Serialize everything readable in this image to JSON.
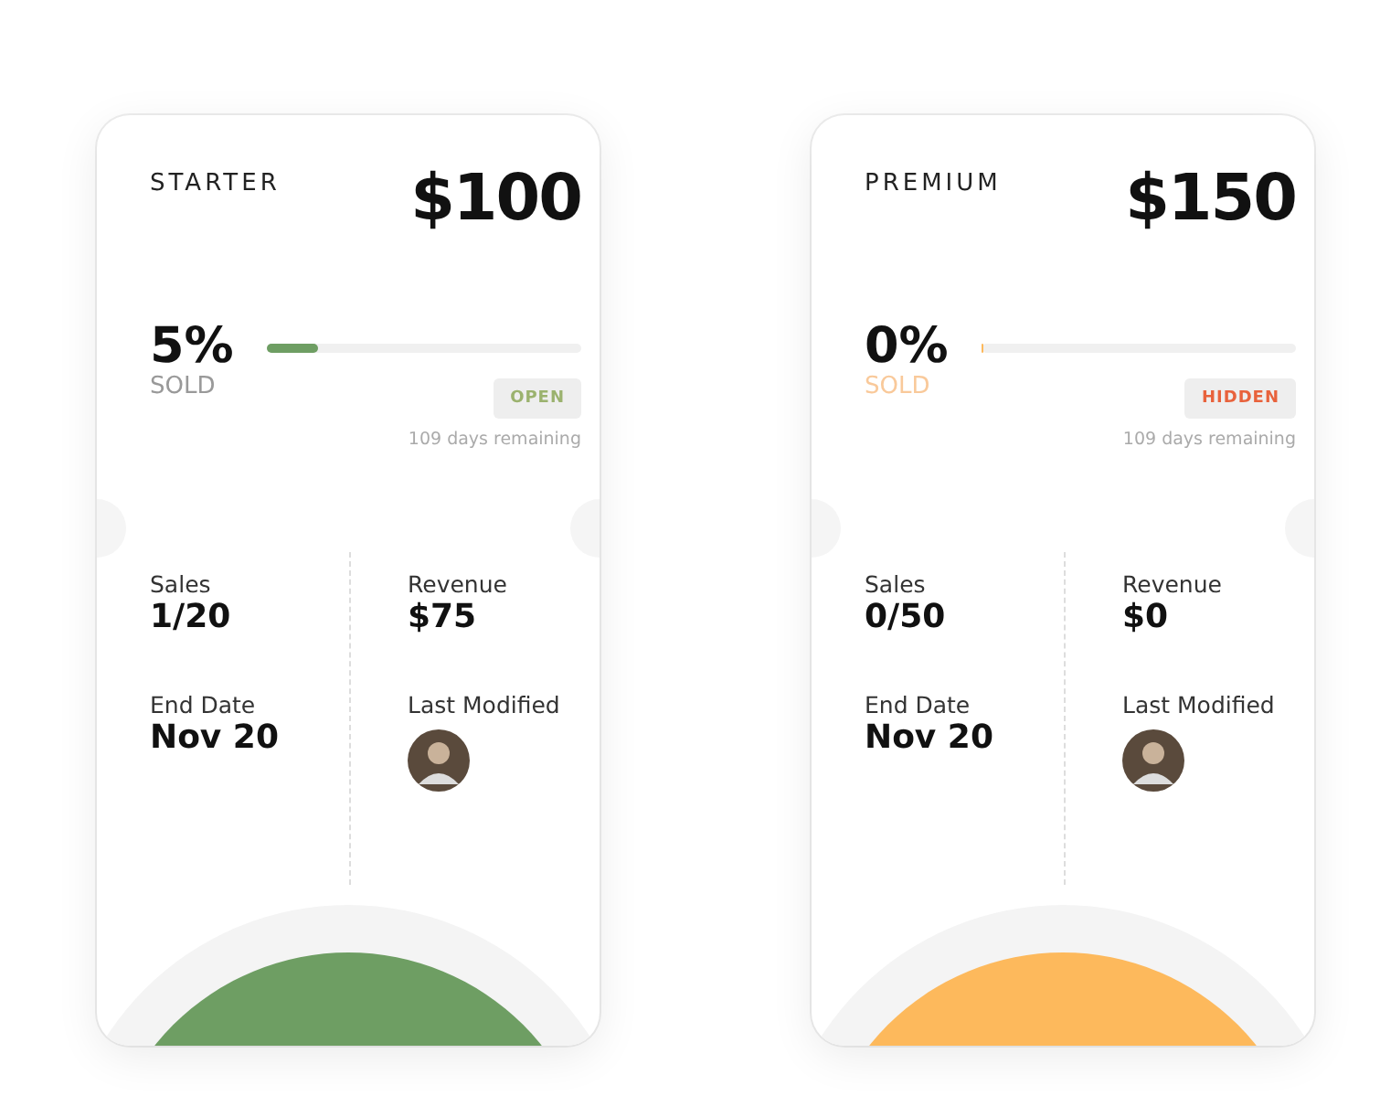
{
  "cards": [
    {
      "tier": "STARTER",
      "price": "$100",
      "percent": "5%",
      "sold_label": "SOLD",
      "level": 0.16,
      "color": "#6e9e63",
      "badge": {
        "label": "OPEN",
        "kind": "open"
      },
      "remaining": "109 days remaining",
      "stats": [
        {
          "label": "Sales",
          "value": "1/20"
        },
        {
          "label": "Revenue",
          "value": "$75"
        },
        {
          "label": "End Date",
          "value": "Nov 20"
        }
      ],
      "modified_label": "Last Modified"
    },
    {
      "tier": "PREMIUM",
      "price": "$150",
      "percent": "0%",
      "sold_label": "SOLD",
      "level": 0,
      "color": "#fdb95c",
      "badge": {
        "label": "HIDDEN",
        "kind": "hidden"
      },
      "remaining": "109 days remaining",
      "stats": [
        {
          "label": "Sales",
          "value": "0/50"
        },
        {
          "label": "Revenue",
          "value": "$0"
        },
        {
          "label": "End Date",
          "value": "Nov 20"
        }
      ],
      "modified_label": "Last Modified"
    }
  ]
}
